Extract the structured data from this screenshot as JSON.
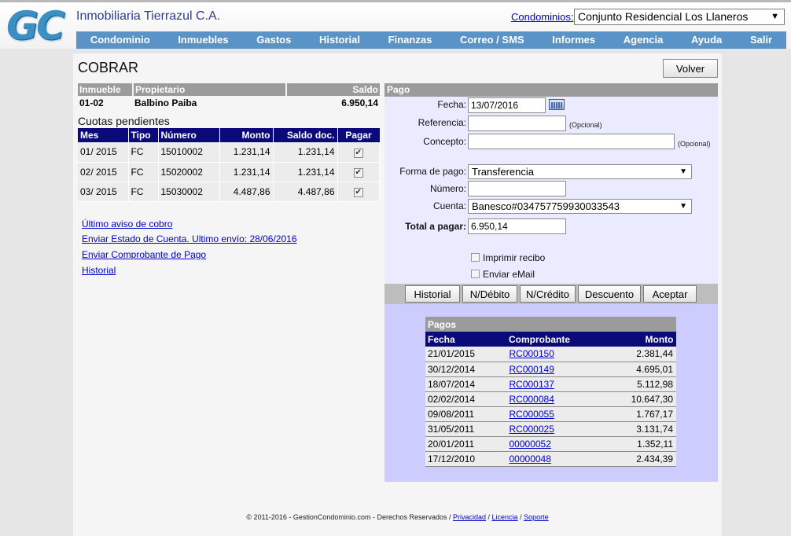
{
  "header": {
    "logo": "GC",
    "company": "Inmobiliaria Tierrazul C.A.",
    "condo_label": "Condominios:",
    "condo_selected": "Conjunto Residencial Los Llaneros"
  },
  "menu": [
    "Condominio",
    "Inmuebles",
    "Gastos",
    "Historial",
    "Finanzas",
    "Correo / SMS",
    "Informes",
    "Agencia",
    "Ayuda",
    "Salir"
  ],
  "page": {
    "title": "COBRAR",
    "volver": "Volver"
  },
  "propietario": {
    "headers": {
      "inmueble": "Inmueble",
      "propietario": "Propietario",
      "saldo": "Saldo"
    },
    "inmueble": "01-02",
    "nombre": "Balbino Paiba",
    "saldo": "6.950,14"
  },
  "cuotas": {
    "title": "Cuotas pendientes",
    "headers": {
      "mes": "Mes",
      "tipo": "Tipo",
      "numero": "Número",
      "monto": "Monto",
      "saldo": "Saldo doc.",
      "pagar": "Pagar"
    },
    "rows": [
      {
        "mes": "01/ 2015",
        "tipo": "FC",
        "numero": "15010002",
        "monto": "1.231,14",
        "saldo": "1.231,14",
        "check": "✔"
      },
      {
        "mes": "02/ 2015",
        "tipo": "FC",
        "numero": "15020002",
        "monto": "1.231,14",
        "saldo": "1.231,14",
        "check": "✔"
      },
      {
        "mes": "03/ 2015",
        "tipo": "FC",
        "numero": "15030002",
        "monto": "4.487,86",
        "saldo": "4.487,86",
        "check": "✔"
      }
    ]
  },
  "links": {
    "ultimo_aviso": "Último aviso de cobro",
    "estado_cuenta": "Enviar Estado de Cuenta. Ultimo envío: 28/06/2016",
    "comprobante": "Enviar Comprobante de Pago",
    "historial": "Historial"
  },
  "pago": {
    "header": "Pago",
    "fecha_label": "Fecha:",
    "fecha_value": "13/07/2016",
    "referencia_label": "Referencia:",
    "referencia_value": "",
    "opcional": "(Opcional)",
    "concepto_label": "Concepto:",
    "concepto_value": "",
    "forma_label": "Forma de pago:",
    "forma_value": "Transferencia",
    "numero_label": "Número:",
    "numero_value": "",
    "cuenta_label": "Cuenta:",
    "cuenta_value": "Banesco#034757759930033543",
    "total_label": "Total a pagar:",
    "total_value": "6.950,14",
    "imprimir": "Imprimir recibo",
    "email": "Enviar eMail"
  },
  "buttons": {
    "historial": "Historial",
    "ndebito": "N/Débito",
    "ncredito": "N/Crédito",
    "descuento": "Descuento",
    "aceptar": "Aceptar"
  },
  "pagos": {
    "title": "Pagos",
    "headers": {
      "fecha": "Fecha",
      "comprobante": "Comprobante",
      "monto": "Monto"
    },
    "rows": [
      {
        "fecha": "21/01/2015",
        "comprobante": "RC000150",
        "monto": "2.381,44"
      },
      {
        "fecha": "30/12/2014",
        "comprobante": "RC000149",
        "monto": "4.695,01"
      },
      {
        "fecha": "18/07/2014",
        "comprobante": "RC000137",
        "monto": "5.112,98"
      },
      {
        "fecha": "02/02/2014",
        "comprobante": "RC000084",
        "monto": "10.647,30"
      },
      {
        "fecha": "09/08/2011",
        "comprobante": "RC000055",
        "monto": "1.767,17"
      },
      {
        "fecha": "31/05/2011",
        "comprobante": "RC000025",
        "monto": "3.131,74"
      },
      {
        "fecha": "20/01/2011",
        "comprobante": "00000052",
        "monto": "1.352,11"
      },
      {
        "fecha": "17/12/2010",
        "comprobante": "00000048",
        "monto": "2.434,39"
      }
    ]
  },
  "footer": {
    "text": "© 2011-2016 - GestionCondominio.com - Derechos Reservados / ",
    "privacidad": "Privacidad",
    "licencia": "Licencia",
    "soporte": "Soporte",
    "sep": " / "
  }
}
